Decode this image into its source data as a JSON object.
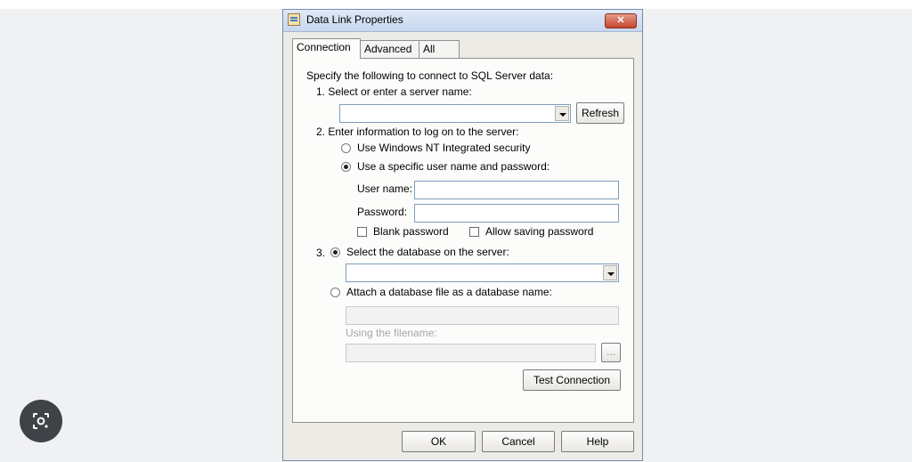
{
  "window": {
    "title": "Data Link Properties",
    "close_glyph": "✕"
  },
  "tabs": [
    "Connection",
    "Advanced",
    "All"
  ],
  "connection": {
    "intro": "Specify the following to connect to SQL Server data:",
    "step1": "1. Select or enter a server name:",
    "server_value": "",
    "refresh_label": "Refresh",
    "step2": "2. Enter information to log on to the server:",
    "radio_windows_nt": "Use Windows NT Integrated security",
    "radio_specific_user": "Use a specific user name and password:",
    "user_name_label": "User name:",
    "user_name_value": "",
    "password_label": "Password:",
    "password_value": "",
    "blank_password": "Blank password",
    "allow_saving_password": "Allow saving password",
    "step3_prefix": "3.",
    "radio_select_database": "Select the database on the server:",
    "database_value": "",
    "radio_attach_file": "Attach a database file as a database name:",
    "attach_value": "",
    "using_filename_label": "Using the filename:",
    "filename_value": "",
    "browse_label": "...",
    "test_connection_label": "Test Connection"
  },
  "footer": {
    "ok": "OK",
    "cancel": "Cancel",
    "help": "Help"
  },
  "overlay": {
    "icon": "lens-search-icon"
  }
}
